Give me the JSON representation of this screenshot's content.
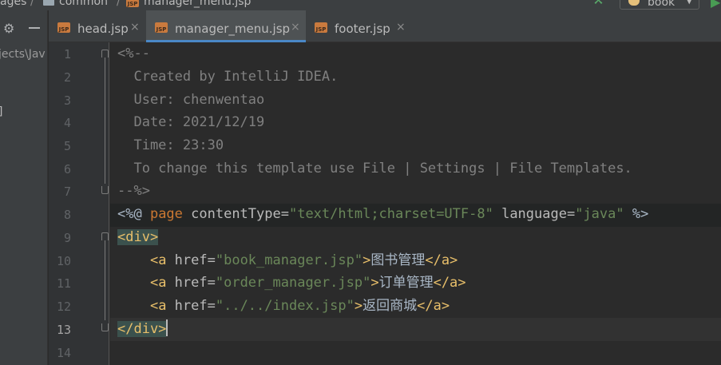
{
  "breadcrumbs": [
    "ages",
    "/",
    "common",
    "/",
    "manager_menu.jsp"
  ],
  "run_config": {
    "label": "book"
  },
  "project_panel": {
    "path_text": "jects\\Jav",
    "bracket_text": "]"
  },
  "tabs": [
    {
      "label": "head.jsp",
      "icon": "jsp-file-icon",
      "active": false
    },
    {
      "label": "manager_menu.jsp",
      "icon": "jsp-file-icon",
      "active": true
    },
    {
      "label": "footer.jsp",
      "icon": "jsp-file-icon",
      "active": false
    }
  ],
  "tab_close_glyph": "×",
  "jsp_badge": "JSP",
  "editor": {
    "current_line": 13,
    "line_numbers": [
      "1",
      "2",
      "3",
      "4",
      "5",
      "6",
      "7",
      "8",
      "9",
      "10",
      "11",
      "12",
      "13",
      "14"
    ],
    "lines": {
      "l1": "<%--",
      "l2": "  Created by IntelliJ IDEA.",
      "l3": "  User: chenwentao",
      "l4": "  Date: 2021/12/19",
      "l5": "  Time: 23:30",
      "l6": "  To change this template use File | Settings | File Templates.",
      "l7": "--%>",
      "l8": {
        "open": "<%@ ",
        "kw": "page",
        "attr1": " contentType=",
        "val1": "\"text/html;charset=UTF-8\"",
        "attr2": " language=",
        "val2": "\"java\"",
        "close": " %>"
      },
      "l9": "<div>",
      "l10": {
        "indent": "    ",
        "open": "<a ",
        "attr": "href=",
        "val": "\"book_manager.jsp\"",
        "gt": ">",
        "text": "图书管理",
        "close": "</a>"
      },
      "l11": {
        "indent": "    ",
        "open": "<a ",
        "attr": "href=",
        "val": "\"order_manager.jsp\"",
        "gt": ">",
        "text": "订单管理",
        "close": "</a>"
      },
      "l12": {
        "indent": "    ",
        "open": "<a ",
        "attr": "href=",
        "val": "\"../../index.jsp\"",
        "gt": ">",
        "text": "返回商城",
        "close": "</a>"
      },
      "l13": "</div>"
    }
  },
  "colors": {
    "background": "#2b2b2b",
    "comment": "#808080",
    "keyword": "#cc7832",
    "string": "#6a8759",
    "tag": "#e8bf6a",
    "active_tab_underline": "#4a88c7"
  }
}
